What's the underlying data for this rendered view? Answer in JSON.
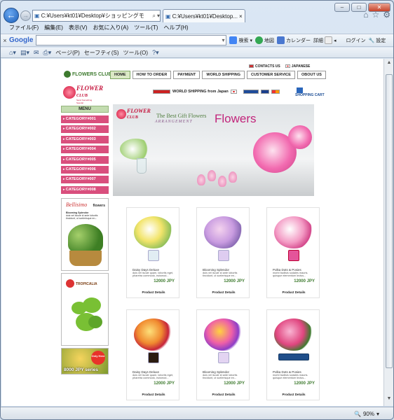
{
  "browser": {
    "address": "C:¥Users¥kt01¥Desktop¥ショッピングモ",
    "tab_title": "C:¥Users¥kt01¥Desktop...",
    "menu": [
      "ファイル(F)",
      "編集(E)",
      "表示(V)",
      "お気に入り(A)",
      "ツール(T)",
      "ヘルプ(H)"
    ],
    "google": {
      "logo": "Google",
      "search_label": "検索",
      "buttons": [
        "地図",
        "カレンダー",
        "詳細",
        "ログイン",
        "設定"
      ]
    },
    "cmd": [
      "ページ(P)",
      "セーフティ(S)",
      "ツール(O)"
    ],
    "zoom": "90%"
  },
  "site": {
    "contact": "CONTACTS US",
    "japanese": "JAPANESE",
    "club": "FLOWERS CLUB",
    "nav": [
      "HOME",
      "HOW TO ORDER",
      "PAYMENT",
      "WORLD SHIPPING",
      "CUSTOMER SERVICE",
      "OBOUT US"
    ],
    "logo_line1": "FLOWER",
    "logo_line2": "CLUB",
    "logo_sub": "Send Something Special",
    "shipping": "WORLD SHIPPING from Japan",
    "cart": "SHOPPING CART",
    "menu_title": "MENU",
    "categories": [
      "CATEGORY#001",
      "CATEGORY#002",
      "CATEGORY#003",
      "CATEGORY#004",
      "CATEGORY#005",
      "CATEGORY#006",
      "CATEGORY#007",
      "CATEGORY#008"
    ],
    "ad1": {
      "script": "Bellisimo",
      "brand": "flowers",
      "sub": "Blooming Splendor",
      "body": "duis vel iscule id ante lobortis tincidunt, ut scelerisque en..."
    },
    "ad2": {
      "brand": "TROPICALIA"
    },
    "ad3": {
      "badge": "Only Here",
      "price": "8000 JPY series"
    },
    "banner": {
      "logo1": "FLOWER",
      "logo2": "CLUB",
      "tagline": "The Best Gift Flowers",
      "script": "ARRANGEMENT",
      "word": "Flowers"
    },
    "products": [
      {
        "name": "Daisy Days Deluxe",
        "desc": "duis vel iscule quam, lobortis eget, pharetra commodo, euismod...",
        "price": "12000 JPY",
        "details": "Product Details"
      },
      {
        "name": "Blooming Splendor",
        "desc": "duis vel iscule id ante lobortis tincidunt, ut scelerisque en...",
        "price": "12000 JPY",
        "details": "Product Details"
      },
      {
        "name": "Polka Dots & Posies",
        "desc": "morbi facilisis sodales mauris. quisque elementum lectus...",
        "price": "12000 JPY",
        "details": "Product Details"
      },
      {
        "name": "Daisy Days Deluxe",
        "desc": "duis vel iscule quam, lobortis eget, pharetra commodo, euismod...",
        "price": "12000 JPY",
        "details": "Product Details"
      },
      {
        "name": "Blooming Splendor",
        "desc": "duis vel iscule id ante lobortis tincidunt, ut scelerisque en...",
        "price": "12000 JPY",
        "details": "Product Details"
      },
      {
        "name": "Polka Dots & Posies",
        "desc": "morbi facilisis sodales mauris. quisque elementum lectus...",
        "price": "12000 JPY",
        "details": "Product Details"
      }
    ]
  }
}
